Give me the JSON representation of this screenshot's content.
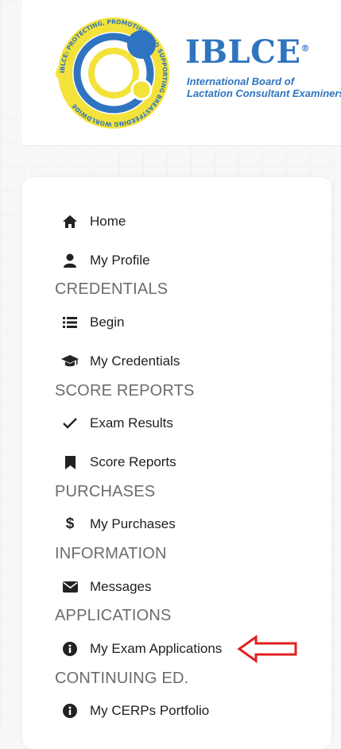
{
  "brand": {
    "title": "IBLCE",
    "registered": "®",
    "subtitle_line1": "International Board of",
    "subtitle_line2": "Lactation Consultant Examiners",
    "seal_text": "IBLCE: PROTECTING, PROMOTING AND SUPPORTING BREASTFEEDING WORLDWIDE",
    "colors": {
      "blue": "#2f74c0",
      "yellow": "#f3e23a"
    }
  },
  "nav": {
    "home": {
      "label": "Home",
      "icon": "home-icon"
    },
    "profile": {
      "label": "My Profile",
      "icon": "user-icon"
    },
    "credentials_heading": "CREDENTIALS",
    "begin": {
      "label": "Begin",
      "icon": "list-icon"
    },
    "my_credentials": {
      "label": "My Credentials",
      "icon": "graduation-cap-icon"
    },
    "score_reports_heading": "SCORE REPORTS",
    "exam_results": {
      "label": "Exam Results",
      "icon": "check-icon"
    },
    "score_reports": {
      "label": "Score Reports",
      "icon": "bookmark-icon"
    },
    "purchases_heading": "PURCHASES",
    "my_purchases": {
      "label": "My Purchases",
      "icon": "dollar-icon"
    },
    "information_heading": "INFORMATION",
    "messages": {
      "label": "Messages",
      "icon": "envelope-icon"
    },
    "applications_heading": "APPLICATIONS",
    "my_exam_applications": {
      "label": "My Exam Applications",
      "icon": "info-circle-icon"
    },
    "continuing_ed_heading": "CONTINUING ED.",
    "my_cerps_portfolio": {
      "label": "My CERPs Portfolio",
      "icon": "info-circle-icon"
    }
  },
  "annotation": {
    "arrow_color": "#e02020"
  }
}
